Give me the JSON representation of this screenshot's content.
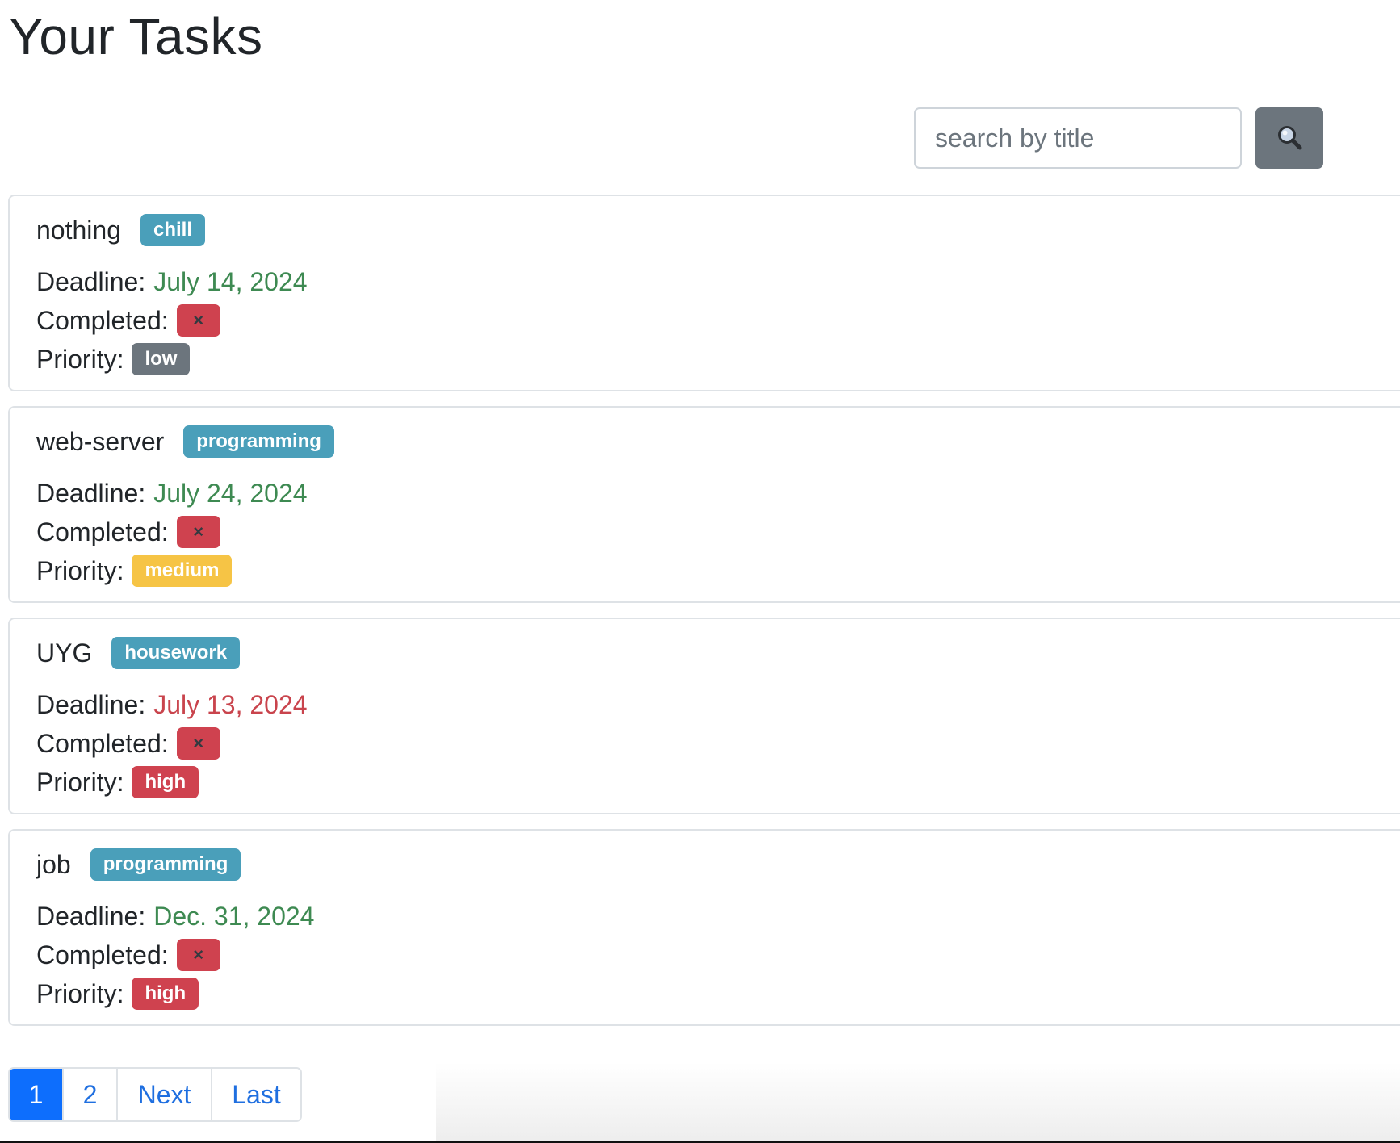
{
  "page": {
    "title": "Your Tasks"
  },
  "search": {
    "placeholder": "search by title",
    "value": "",
    "button_icon": "magnifier-icon"
  },
  "labels": {
    "deadline": "Deadline:",
    "completed": "Completed:",
    "priority": "Priority:"
  },
  "tasks": [
    {
      "title": "nothing",
      "category": "chill",
      "deadline": "July 14, 2024",
      "deadline_status": "upcoming",
      "completed": "×",
      "priority": "low"
    },
    {
      "title": "web-server",
      "category": "programming",
      "deadline": "July 24, 2024",
      "deadline_status": "upcoming",
      "completed": "×",
      "priority": "medium"
    },
    {
      "title": "UYG",
      "category": "housework",
      "deadline": "July 13, 2024",
      "deadline_status": "overdue",
      "completed": "×",
      "priority": "high"
    },
    {
      "title": "job",
      "category": "programming",
      "deadline": "Dec. 31, 2024",
      "deadline_status": "upcoming",
      "completed": "×",
      "priority": "high"
    }
  ],
  "pagination": {
    "pages": [
      "1",
      "2"
    ],
    "current": "1",
    "next_label": "Next",
    "last_label": "Last"
  },
  "colors": {
    "category_badge": "#4a9fba",
    "priority_low": "#6c757d",
    "priority_medium": "#f6c445",
    "priority_high": "#cf424f",
    "deadline_upcoming": "#3e8a52",
    "deadline_overdue": "#c9444d",
    "active_page": "#0d6efd",
    "link": "#1f6fe0"
  }
}
